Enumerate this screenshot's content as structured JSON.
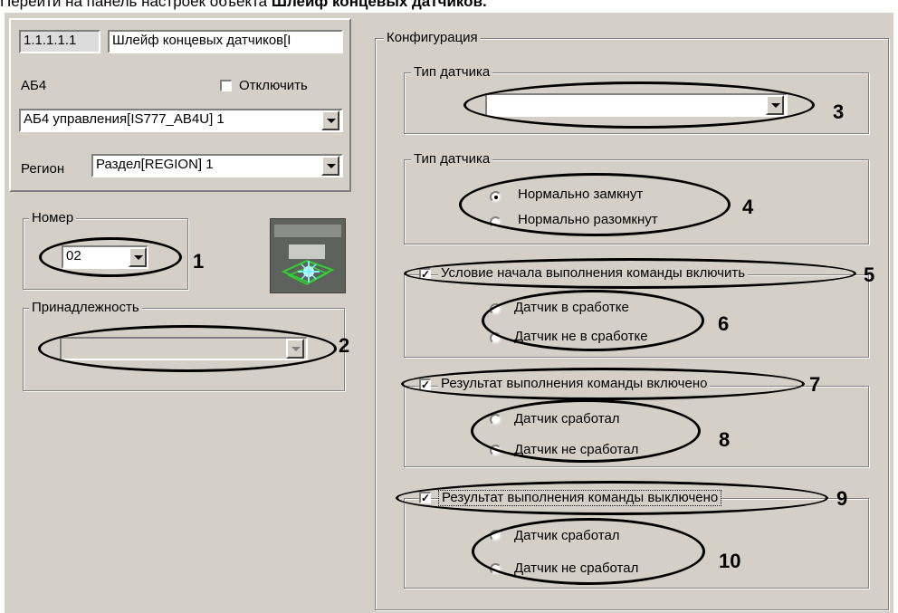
{
  "caption": {
    "prefix": "Перейти на панель настроек объекта ",
    "bold": "Шлейф концевых датчиков."
  },
  "header": {
    "id_value": "1.1.1.1.1",
    "name_value": "Шлейф концевых датчиков[I",
    "parent_type_label": "АБ4",
    "disable_label": "Отключить",
    "parent_select_value": "АБ4 управления[IS777_AB4U] 1",
    "region_label": "Регион",
    "region_select_value": "Раздел[REGION] 1"
  },
  "number_group": {
    "title": "Номер",
    "value": "02"
  },
  "belonging_group": {
    "title": "Принадлежность",
    "value": ""
  },
  "config": {
    "title": "Конфигурация",
    "sensor_type_group": {
      "title": "Тип датчика",
      "value": ""
    },
    "sensor_mode_group": {
      "title": "Тип датчика",
      "options": [
        "Нормально замкнут",
        "Нормально разомкнут"
      ],
      "selected": 0
    },
    "start_condition": {
      "label": "Условие начала выполнения команды включить",
      "checked": true,
      "options": [
        "Датчик в сработке",
        "Датчик не в сработке"
      ]
    },
    "on_result": {
      "label": "Результат выполнения команды включено",
      "checked": true,
      "options": [
        "Датчик сработал",
        "Датчик не сработал"
      ]
    },
    "off_result": {
      "label": "Результат выполнения команды выключено",
      "checked": true,
      "options": [
        "Датчик сработал",
        "Датчик не сработал"
      ]
    }
  },
  "callouts": [
    "1",
    "2",
    "3",
    "4",
    "5",
    "6",
    "7",
    "8",
    "9",
    "10"
  ],
  "colors": {
    "panel": "#d4d0c8",
    "annotation": "#000000"
  }
}
